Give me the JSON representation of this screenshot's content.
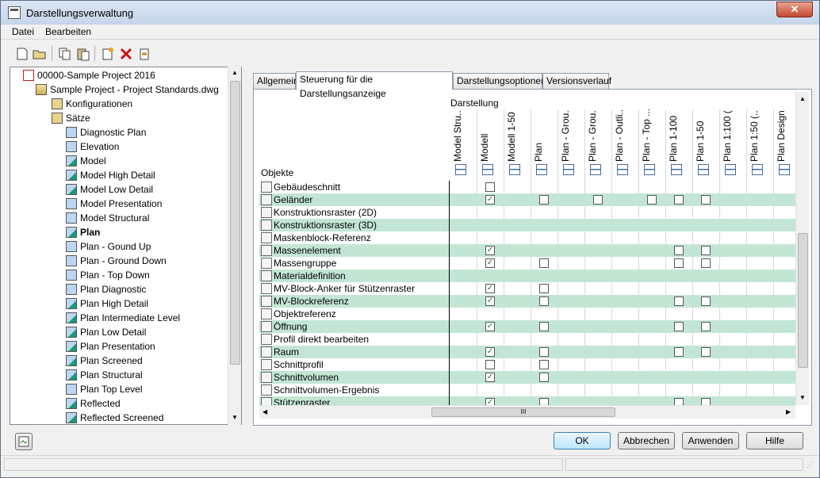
{
  "window": {
    "title": "Darstellungsverwaltung",
    "close_label": "✕"
  },
  "menu": [
    {
      "label": "Datei",
      "underline": "D"
    },
    {
      "label": "Bearbeiten",
      "underline": "B"
    }
  ],
  "toolbar": {
    "icons": [
      "new-icon",
      "open-icon",
      "copy-icon",
      "paste-icon",
      "new-set-icon",
      "delete-icon",
      "purge-icon"
    ]
  },
  "tree": {
    "items": [
      {
        "label": "00000-Sample Project 2016",
        "level": 0,
        "bold": false,
        "icon": "project-icon"
      },
      {
        "label": "Sample Project - Project Standards.dwg",
        "level": 1,
        "bold": false,
        "icon": "drawing-icon"
      },
      {
        "label": "Konfigurationen",
        "level": 2,
        "bold": false,
        "icon": "folder-icon"
      },
      {
        "label": "Sätze",
        "level": 2,
        "bold": false,
        "icon": "folder-icon"
      },
      {
        "label": "Diagnostic Plan",
        "level": 3,
        "bold": false,
        "icon": "set-icon"
      },
      {
        "label": "Elevation",
        "level": 3,
        "bold": false,
        "icon": "set-icon"
      },
      {
        "label": "Model",
        "level": 3,
        "bold": false,
        "icon": "set-active-icon"
      },
      {
        "label": "Model High Detail",
        "level": 3,
        "bold": false,
        "icon": "set-active-icon"
      },
      {
        "label": "Model Low Detail",
        "level": 3,
        "bold": false,
        "icon": "set-active-icon"
      },
      {
        "label": "Model Presentation",
        "level": 3,
        "bold": false,
        "icon": "set-icon"
      },
      {
        "label": "Model Structural",
        "level": 3,
        "bold": false,
        "icon": "set-icon"
      },
      {
        "label": "Plan",
        "level": 3,
        "bold": true,
        "icon": "set-active-icon"
      },
      {
        "label": "Plan - Gound Up",
        "level": 3,
        "bold": false,
        "icon": "set-icon"
      },
      {
        "label": "Plan - Ground Down",
        "level": 3,
        "bold": false,
        "icon": "set-icon"
      },
      {
        "label": "Plan - Top Down",
        "level": 3,
        "bold": false,
        "icon": "set-icon"
      },
      {
        "label": "Plan Diagnostic",
        "level": 3,
        "bold": false,
        "icon": "set-icon"
      },
      {
        "label": "Plan High Detail",
        "level": 3,
        "bold": false,
        "icon": "set-active-icon"
      },
      {
        "label": "Plan Intermediate Level",
        "level": 3,
        "bold": false,
        "icon": "set-active-icon"
      },
      {
        "label": "Plan Low Detail",
        "level": 3,
        "bold": false,
        "icon": "set-active-icon"
      },
      {
        "label": "Plan Presentation",
        "level": 3,
        "bold": false,
        "icon": "set-active-icon"
      },
      {
        "label": "Plan Screened",
        "level": 3,
        "bold": false,
        "icon": "set-active-icon"
      },
      {
        "label": "Plan Structural",
        "level": 3,
        "bold": false,
        "icon": "set-active-icon"
      },
      {
        "label": "Plan Top Level",
        "level": 3,
        "bold": false,
        "icon": "set-icon"
      },
      {
        "label": "Reflected",
        "level": 3,
        "bold": false,
        "icon": "set-active-icon"
      },
      {
        "label": "Reflected Screened",
        "level": 3,
        "bold": false,
        "icon": "set-active-icon"
      }
    ]
  },
  "tabs": [
    {
      "label": "Allgemein",
      "active": false
    },
    {
      "label": "Steuerung für die Darstellungsanzeige",
      "active": true
    },
    {
      "label": "Darstellungsoptionen",
      "active": false
    },
    {
      "label": "Versionsverlauf",
      "active": false
    }
  ],
  "grid": {
    "group_label": "Darstellung",
    "objects_label": "Objekte",
    "columns": [
      "Model Stru...",
      "Modell",
      "Modell 1-50",
      "Plan",
      "Plan - Grou...",
      "Plan - Grou...",
      "Plan - Outli...",
      "Plan - Top ...",
      "Plan 1-100",
      "Plan 1-50",
      "Plan 1:100 (...",
      "Plan 1:50 (...",
      "Plan Design"
    ],
    "rows": [
      {
        "label": "Gebäudeschnitt",
        "icon": "building-section-icon",
        "cells": [
          0,
          1,
          0,
          0,
          0,
          0,
          0,
          0,
          0,
          0,
          0,
          0,
          0
        ]
      },
      {
        "label": "Geländer",
        "icon": "railing-icon",
        "cells": [
          0,
          2,
          0,
          1,
          0,
          1,
          0,
          1,
          1,
          1,
          0,
          0,
          0
        ]
      },
      {
        "label": "Konstruktionsraster (2D)",
        "icon": "grid-2d-icon",
        "cells": [
          0,
          0,
          0,
          0,
          0,
          0,
          0,
          0,
          0,
          0,
          0,
          0,
          0
        ]
      },
      {
        "label": "Konstruktionsraster (3D)",
        "icon": "grid-3d-icon",
        "cells": [
          0,
          0,
          0,
          0,
          0,
          0,
          0,
          0,
          0,
          0,
          0,
          0,
          0
        ]
      },
      {
        "label": "Maskenblock-Referenz",
        "icon": "mask-block-icon",
        "cells": [
          0,
          0,
          0,
          0,
          0,
          0,
          0,
          0,
          0,
          0,
          0,
          0,
          0
        ]
      },
      {
        "label": "Massenelement",
        "icon": "mass-element-icon",
        "cells": [
          0,
          2,
          0,
          0,
          0,
          0,
          0,
          0,
          1,
          1,
          0,
          0,
          0
        ]
      },
      {
        "label": "Massengruppe",
        "icon": "mass-group-icon",
        "cells": [
          0,
          2,
          0,
          1,
          0,
          0,
          0,
          0,
          1,
          1,
          0,
          0,
          0
        ]
      },
      {
        "label": "Materialdefinition",
        "icon": "material-icon",
        "cells": [
          0,
          0,
          0,
          0,
          0,
          0,
          0,
          0,
          0,
          0,
          0,
          0,
          0
        ]
      },
      {
        "label": "MV-Block-Anker für Stützenraster",
        "icon": "anchor-icon",
        "cells": [
          0,
          2,
          0,
          1,
          0,
          0,
          0,
          0,
          0,
          0,
          0,
          0,
          0
        ]
      },
      {
        "label": "MV-Blockreferenz",
        "icon": "mv-block-icon",
        "cells": [
          0,
          2,
          0,
          1,
          0,
          0,
          0,
          0,
          1,
          1,
          0,
          0,
          0
        ]
      },
      {
        "label": "Objektreferenz",
        "icon": "object-ref-icon",
        "cells": [
          0,
          0,
          0,
          0,
          0,
          0,
          0,
          0,
          0,
          0,
          0,
          0,
          0
        ]
      },
      {
        "label": "Öffnung",
        "icon": "opening-icon",
        "cells": [
          0,
          2,
          0,
          1,
          0,
          0,
          0,
          0,
          1,
          1,
          0,
          0,
          0
        ]
      },
      {
        "label": "Profil direkt bearbeiten",
        "icon": "profile-edit-icon",
        "cells": [
          0,
          0,
          0,
          0,
          0,
          0,
          0,
          0,
          0,
          0,
          0,
          0,
          0
        ]
      },
      {
        "label": "Raum",
        "icon": "space-icon",
        "cells": [
          0,
          2,
          0,
          1,
          0,
          0,
          0,
          0,
          1,
          1,
          0,
          0,
          0
        ]
      },
      {
        "label": "Schnittprofil",
        "icon": "section-profile-icon",
        "cells": [
          0,
          1,
          0,
          1,
          0,
          0,
          0,
          0,
          0,
          0,
          0,
          0,
          0
        ]
      },
      {
        "label": "Schnittvolumen",
        "icon": "section-volume-icon",
        "cells": [
          0,
          2,
          0,
          1,
          0,
          0,
          0,
          0,
          0,
          0,
          0,
          0,
          0
        ]
      },
      {
        "label": "Schnittvolumen-Ergebnis",
        "icon": "section-result-icon",
        "cells": [
          0,
          0,
          0,
          0,
          0,
          0,
          0,
          0,
          0,
          0,
          0,
          0,
          0
        ]
      },
      {
        "label": "Stützenraster",
        "icon": "column-grid-icon",
        "cells": [
          0,
          2,
          0,
          1,
          0,
          0,
          0,
          0,
          1,
          1,
          0,
          0,
          0
        ]
      }
    ]
  },
  "buttons": {
    "ok": "OK",
    "cancel": "Abbrechen",
    "apply": "Anwenden",
    "help": "Hilfe"
  },
  "hscroll_thumb": "III",
  "colors": {
    "alt_row": "#c3e6d4",
    "accent": "#3b72b5",
    "check": "#2a7a2a"
  }
}
